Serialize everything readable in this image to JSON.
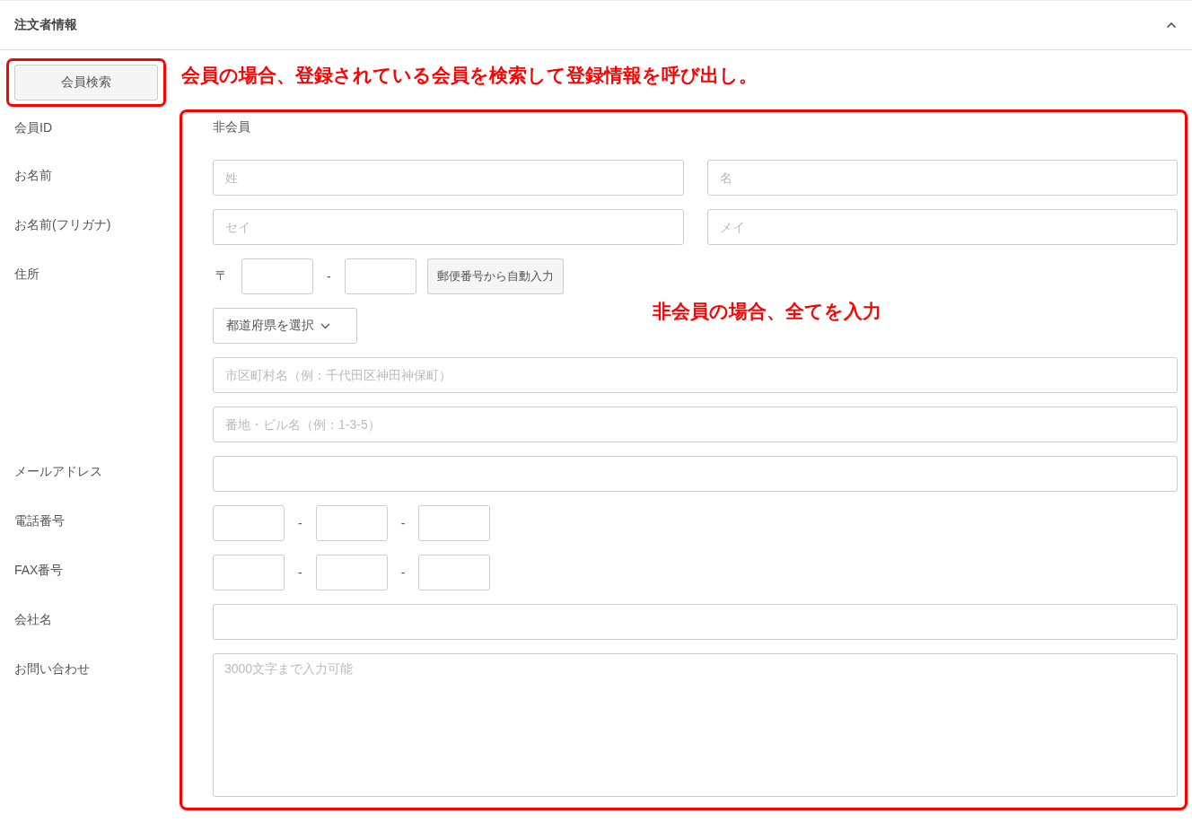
{
  "section": {
    "title": "注文者情報",
    "expanded": true
  },
  "member_search": {
    "button": "会員検索",
    "note": "会員の場合、登録されている会員を検索して登録情報を呼び出し。"
  },
  "member_id": {
    "label": "会員ID",
    "value": "非会員"
  },
  "name": {
    "label": "お名前",
    "fields": [
      {
        "placeholder": "姓"
      },
      {
        "placeholder": "名"
      }
    ]
  },
  "name_kana": {
    "label": "お名前(フリガナ)",
    "fields": [
      {
        "placeholder": "セイ"
      },
      {
        "placeholder": "メイ"
      }
    ]
  },
  "address": {
    "label": "住所",
    "postal_mark": "〒",
    "postal_separator": "-",
    "autofill_button": "郵便番号から自動入力",
    "prefecture_select": "都道府県を選択",
    "city_placeholder": "市区町村名（例：千代田区神田神保町）",
    "street_placeholder": "番地・ビル名（例：1-3-5）"
  },
  "email": {
    "label": "メールアドレス"
  },
  "phone": {
    "label": "電話番号",
    "separators": [
      "-",
      "-"
    ]
  },
  "fax": {
    "label": "FAX番号",
    "separators": [
      "-",
      "-"
    ]
  },
  "company": {
    "label": "会社名"
  },
  "inquiry": {
    "label": "お問い合わせ",
    "placeholder": "3000文字まで入力可能"
  },
  "non_member_note": "非会員の場合、全てを入力"
}
